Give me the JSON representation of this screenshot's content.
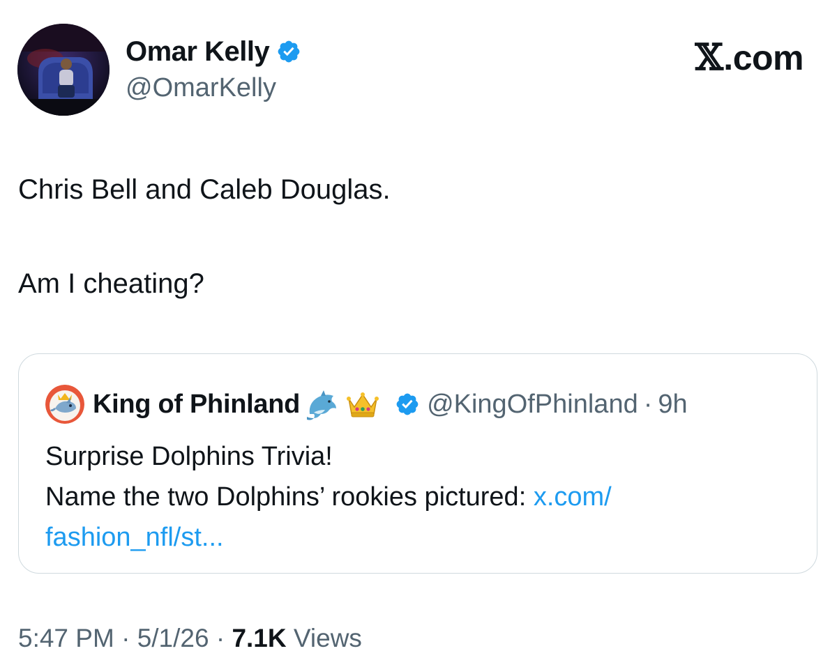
{
  "author": {
    "name": "Omar Kelly",
    "handle": "@OmarKelly",
    "verified": true,
    "avatar_icon": "profile-photo"
  },
  "brand": {
    "x_glyph": "𝕏",
    "domain": ".com"
  },
  "tweet": {
    "line1": "Chris Bell and Caleb Douglas.",
    "line2": "Am I cheating?"
  },
  "quote": {
    "name": "King of Phinland",
    "emojis": [
      "dolphin-emoji",
      "crown-emoji"
    ],
    "handle": "@KingOfPhinland",
    "separator": "·",
    "time": "9h",
    "text_line1": "Surprise Dolphins Trivia!",
    "text_line2": "Name the two Dolphins’ rookies pictured: ",
    "link_part1": "x.com/",
    "link_part2": "fashion_nfl/st..."
  },
  "footer": {
    "time": "5:47 PM",
    "sep1": "·",
    "date": "5/1/26",
    "sep2": "·",
    "views_count": "7.1K",
    "views_label": "Views"
  },
  "colors": {
    "verified_blue": "#1d9bf0",
    "link_blue": "#1d9bf0",
    "secondary_text": "#536471",
    "primary_text": "#0f1419",
    "border": "#cfd9de"
  }
}
